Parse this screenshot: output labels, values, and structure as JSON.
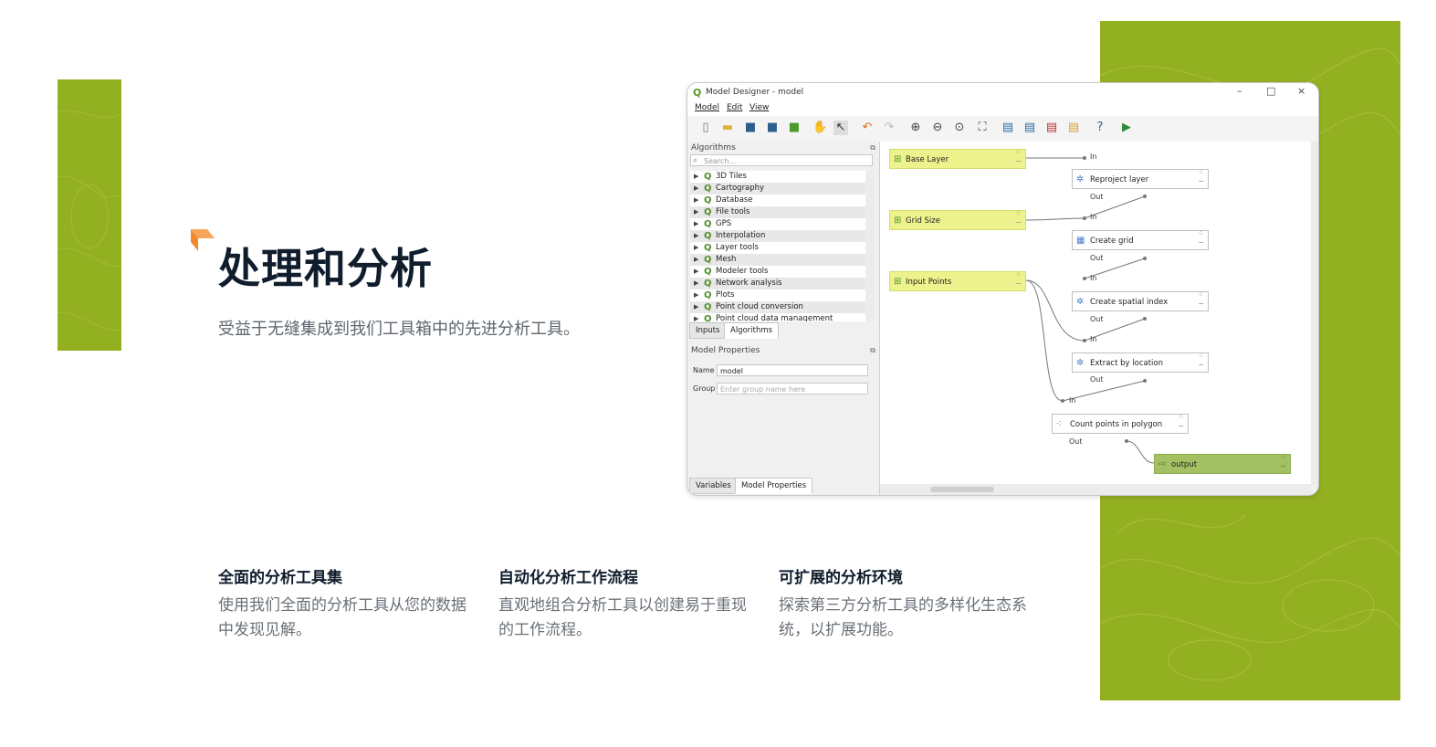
{
  "colors": {
    "accent_green": "#93b021",
    "accent_orange": "#f08a2c",
    "title_navy": "#101d2c",
    "input_node": "#eef28c",
    "output_node": "#a3c063"
  },
  "hero": {
    "title": "处理和分析",
    "subtitle": "受益于无缝集成到我们工具箱中的先进分析工具。"
  },
  "features": [
    {
      "title": "全面的分析工具集",
      "text": "使用我们全面的分析工具从您的数据中发现见解。"
    },
    {
      "title": "自动化分析工作流程",
      "text": "直观地组合分析工具以创建易于重现的工作流程。"
    },
    {
      "title": "可扩展的分析环境",
      "text": "探索第三方分析工具的多样化生态系统，以扩展功能。"
    }
  ],
  "window": {
    "title": "Model Designer - model",
    "controls": {
      "minimize": "–",
      "maximize": "□",
      "close": "×"
    },
    "menu": [
      "Model",
      "Edit",
      "View"
    ],
    "toolbar_icons": [
      "new-model-icon",
      "open-folder-icon",
      "save-icon",
      "save-as-icon",
      "export-image-icon",
      "pan-hand-icon",
      "select-arrow-icon",
      "undo-icon",
      "redo-icon",
      "zoom-in-icon",
      "zoom-out-icon",
      "zoom-actual-icon",
      "zoom-full-icon",
      "export-png-icon",
      "export-svg-icon",
      "export-pdf-icon",
      "export-python-icon",
      "help-icon",
      "run-model-icon"
    ],
    "algorithms_panel": {
      "title": "Algorithms",
      "search_placeholder": "Search...",
      "items": [
        "3D Tiles",
        "Cartography",
        "Database",
        "File tools",
        "GPS",
        "Interpolation",
        "Layer tools",
        "Mesh",
        "Modeler tools",
        "Network analysis",
        "Plots",
        "Point cloud conversion",
        "Point cloud data management"
      ],
      "tabs": [
        "Inputs",
        "Algorithms"
      ]
    },
    "model_properties": {
      "title": "Model Properties",
      "name_label": "Name",
      "name_value": "model",
      "group_label": "Group",
      "group_placeholder": "Enter group name here"
    },
    "bottom_tabs": [
      "Variables",
      "Model Properties"
    ],
    "canvas": {
      "inputs": [
        "Base Layer",
        "Grid Size",
        "Input Points"
      ],
      "algorithms": [
        "Reproject layer",
        "Create grid",
        "Create spatial index",
        "Extract by location",
        "Count points in polygon"
      ],
      "output": "output",
      "port_in": "In",
      "port_out": "Out"
    }
  }
}
